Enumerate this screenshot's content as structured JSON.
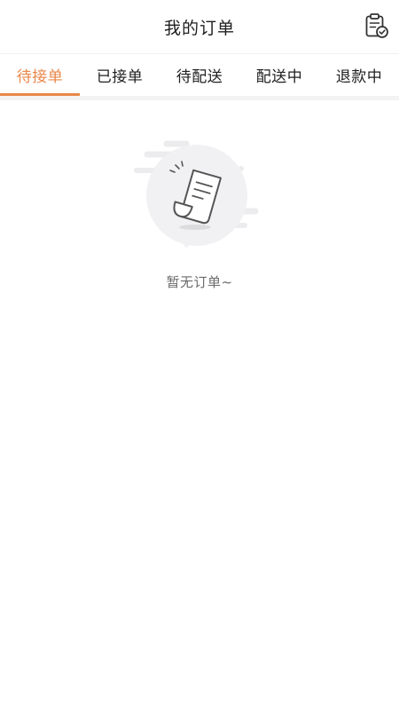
{
  "header": {
    "title": "我的订单",
    "action_icon": "clipboard-check-icon"
  },
  "tabs": [
    {
      "label": "待接单",
      "active": true
    },
    {
      "label": "已接单",
      "active": false
    },
    {
      "label": "待配送",
      "active": false
    },
    {
      "label": "配送中",
      "active": false
    },
    {
      "label": "退款中",
      "active": false
    }
  ],
  "empty_state": {
    "icon": "empty-receipt-icon",
    "message": "暂无订单~"
  },
  "colors": {
    "accent": "#e98749",
    "text_primary": "#1f1f1f",
    "text_secondary": "#6b6b6b",
    "divider": "#f3f3f3"
  }
}
